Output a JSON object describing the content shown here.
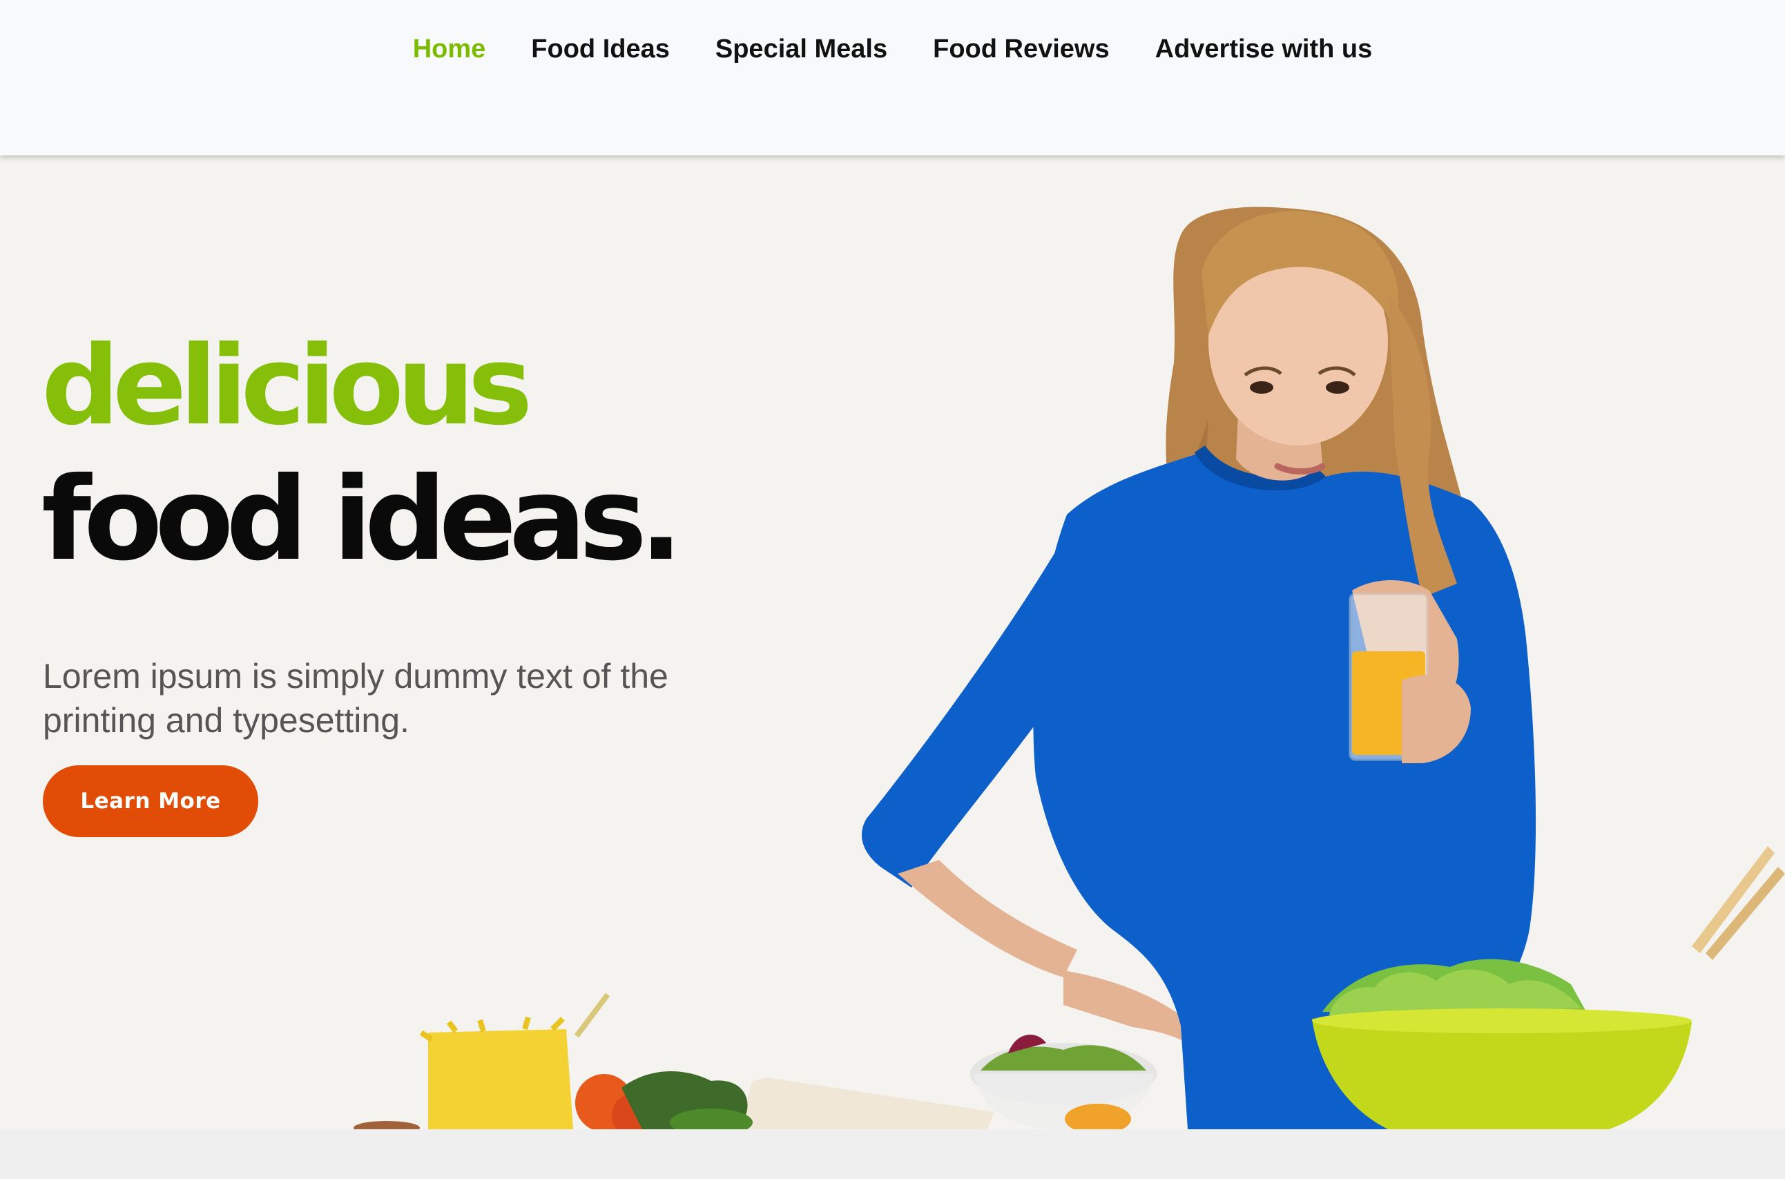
{
  "nav": {
    "items": [
      {
        "label": "Home",
        "active": true
      },
      {
        "label": "Food Ideas",
        "active": false
      },
      {
        "label": "Special Meals",
        "active": false
      },
      {
        "label": "Food Reviews",
        "active": false
      },
      {
        "label": "Advertise with us",
        "active": false
      }
    ]
  },
  "hero": {
    "headline_accent": "delicious",
    "headline_main": "food ideas.",
    "subtext": "Lorem ipsum is simply dummy text of the printing and typesetting.",
    "cta_label": "Learn More",
    "image_subject": "woman-holding-juice-with-vegetables"
  },
  "colors": {
    "accent_green": "#86bf0a",
    "nav_active": "#7cbb00",
    "cta_orange": "#e14d06",
    "hero_background": "#f4f3ef",
    "navbar_background": "#f8f9fa",
    "sweater_blue": "#0d5fc9"
  }
}
